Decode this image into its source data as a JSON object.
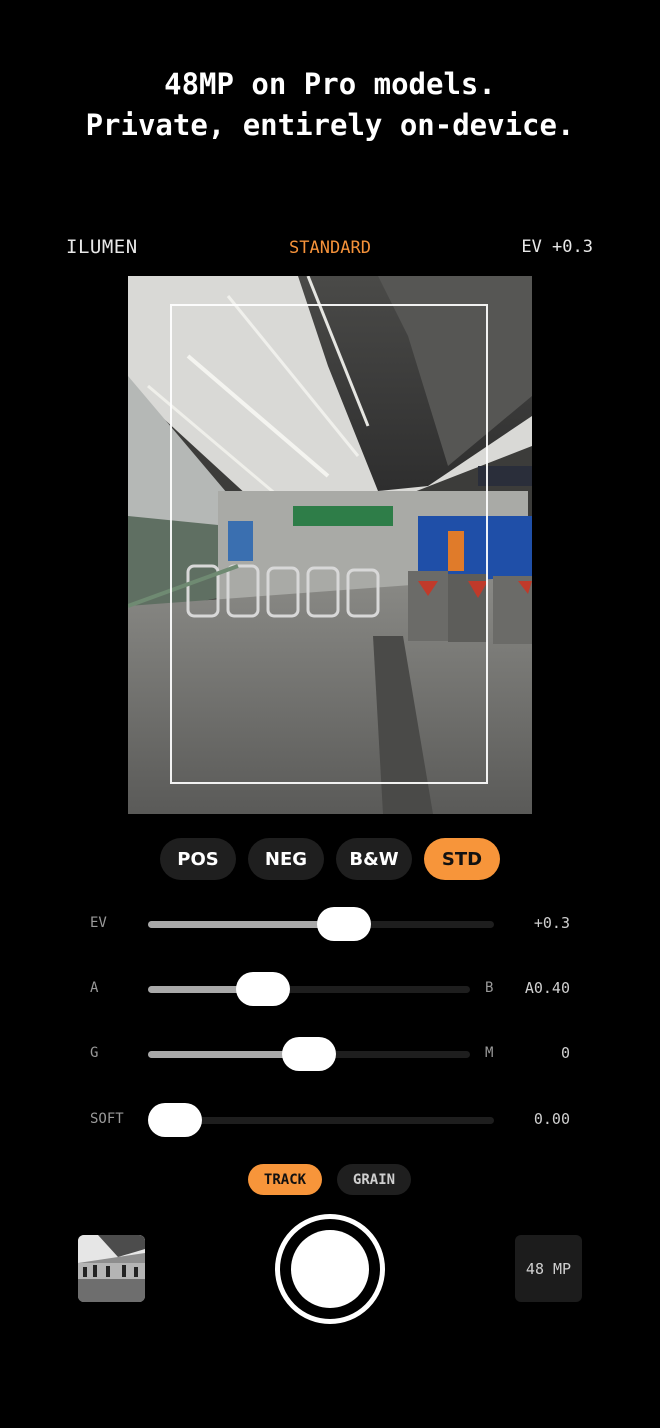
{
  "headline": {
    "line1": "48MP on Pro models.",
    "line2": "Private, entirely on-device."
  },
  "topbar": {
    "brand": "ILUMEN",
    "mode": "STANDARD",
    "exposure": "EV +0.3"
  },
  "film_modes": [
    {
      "label": "POS",
      "active": false
    },
    {
      "label": "NEG",
      "active": false
    },
    {
      "label": "B&W",
      "active": false
    },
    {
      "label": "STD",
      "active": true
    }
  ],
  "sliders": [
    {
      "label": "EV",
      "right_label": "",
      "value": "+0.3",
      "position": 0.58
    },
    {
      "label": "A",
      "right_label": "B",
      "value": "A0.40",
      "position": 0.33
    },
    {
      "label": "G",
      "right_label": "M",
      "value": "0",
      "position": 0.5
    },
    {
      "label": "SOFT",
      "right_label": "",
      "value": "0.00",
      "position": 0.0
    }
  ],
  "toggles": [
    {
      "label": "TRACK",
      "active": true
    },
    {
      "label": "GRAIN",
      "active": false
    }
  ],
  "bottom": {
    "resolution_label": "48 MP"
  },
  "colors": {
    "accent": "#f7953a",
    "background": "#000000"
  }
}
